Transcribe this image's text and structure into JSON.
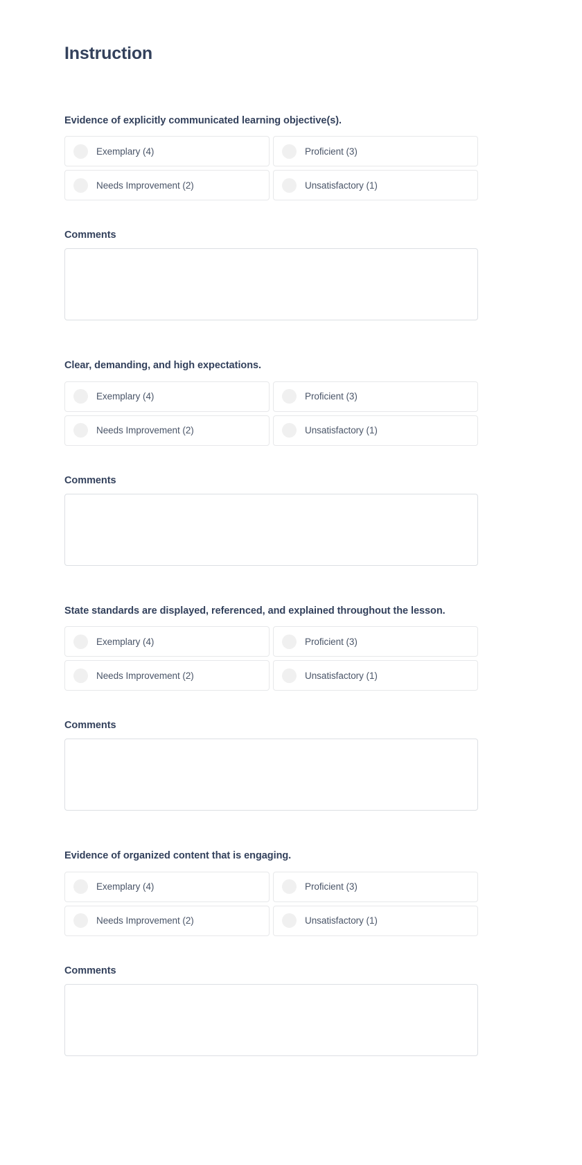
{
  "page": {
    "title": "Instruction"
  },
  "labels": {
    "comments": "Comments"
  },
  "textarea": {
    "value": "",
    "placeholder": ""
  },
  "options": [
    {
      "label": "Exemplary (4)",
      "value": 4
    },
    {
      "label": "Proficient (3)",
      "value": 3
    },
    {
      "label": "Needs Improvement (2)",
      "value": 2
    },
    {
      "label": "Unsatisfactory (1)",
      "value": 1
    }
  ],
  "questions": [
    {
      "title": "Evidence of explicitly communicated learning objective(s).",
      "selected": null,
      "comments": ""
    },
    {
      "title": "Clear, demanding, and high expectations.",
      "selected": null,
      "comments": ""
    },
    {
      "title": "State standards are displayed, referenced, and explained throughout the lesson.",
      "selected": null,
      "comments": ""
    },
    {
      "title": "Evidence of organized content that is engaging.",
      "selected": null,
      "comments": ""
    }
  ],
  "colors": {
    "heading": "#33415c",
    "body_text": "#4a5568",
    "border": "#e7e8ea",
    "textarea_border": "#dcdfe3",
    "radio_fill": "#f0f0f0",
    "background": "#ffffff"
  }
}
